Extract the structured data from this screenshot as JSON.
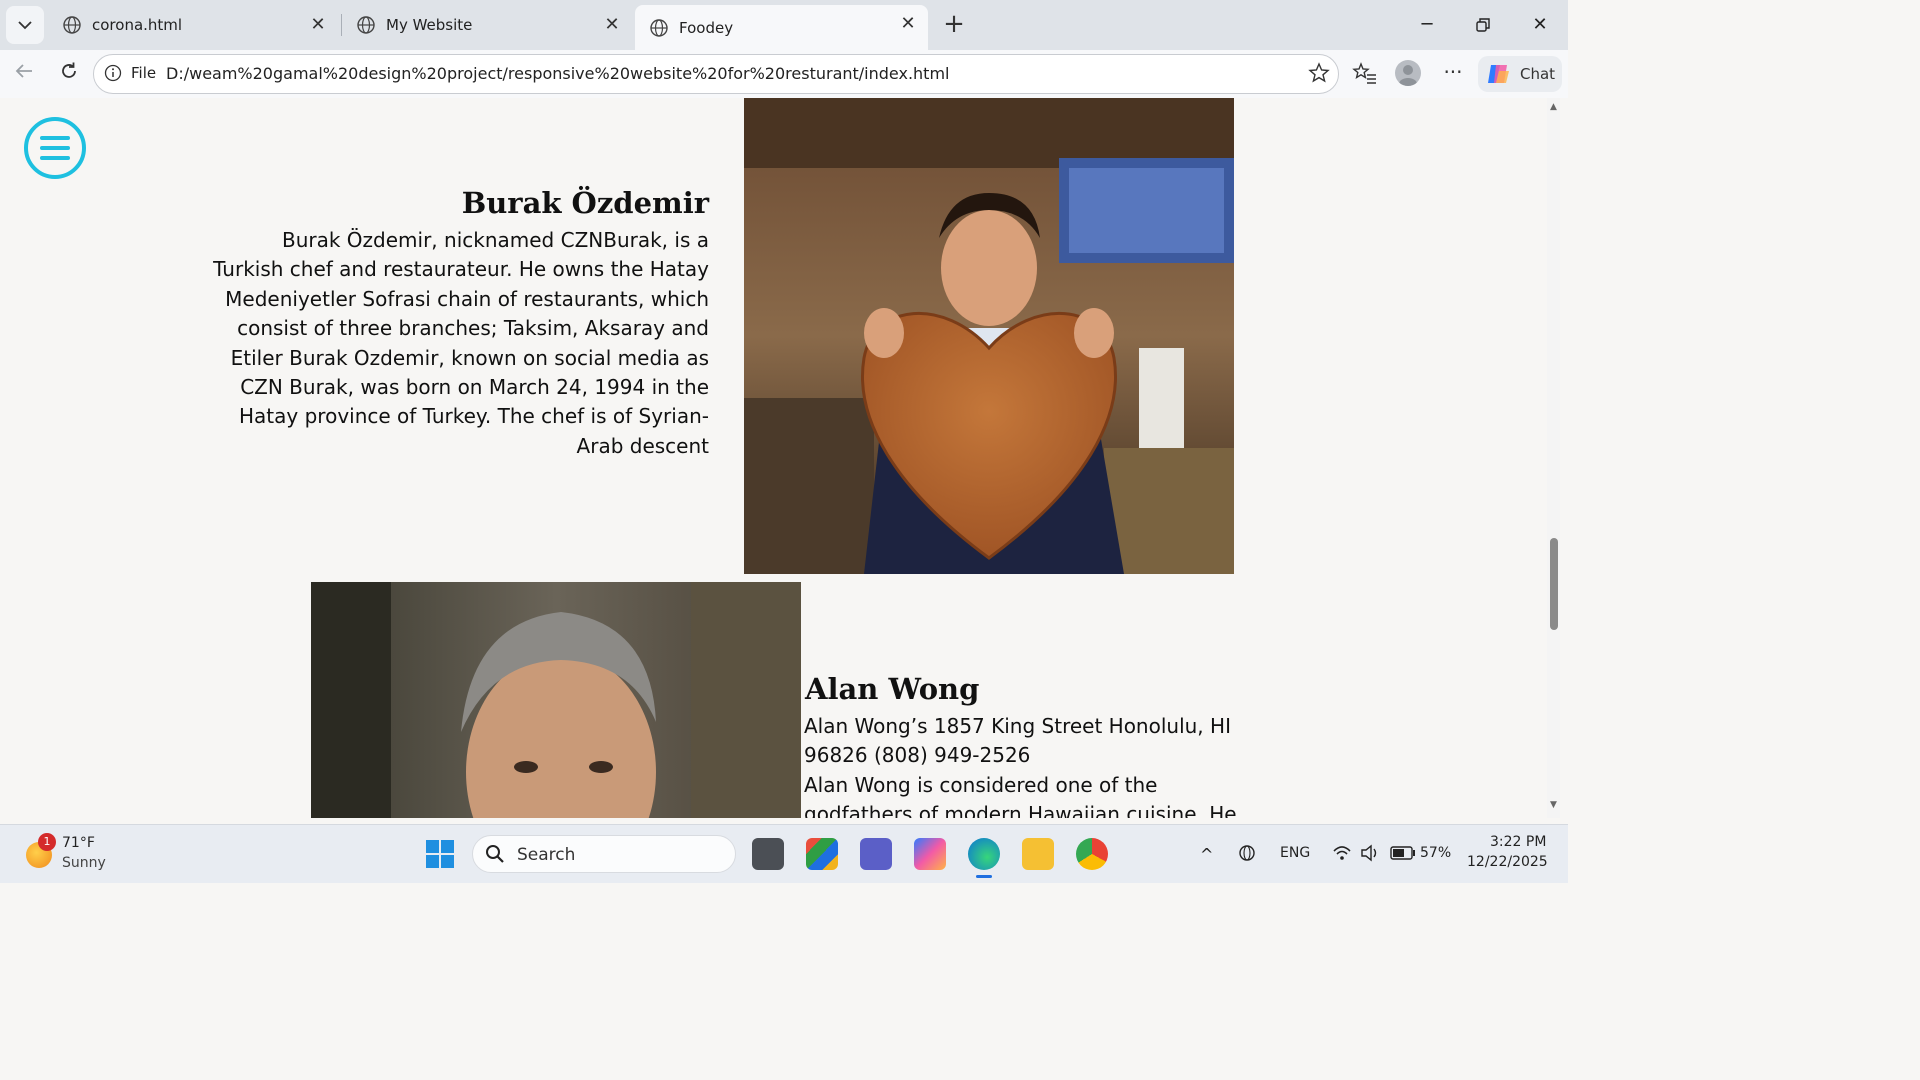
{
  "browser": {
    "tabs": [
      {
        "title": "corona.html",
        "active": false
      },
      {
        "title": "My Website",
        "active": false
      },
      {
        "title": "Foodey",
        "active": true
      }
    ],
    "address": {
      "scheme_label": "File",
      "url": "D:/weam%20gamal%20design%20project/responsive%20website%20for%20resturant/index.html"
    },
    "chat_label": "Chat"
  },
  "page": {
    "chefs": [
      {
        "name": "Burak Özdemir",
        "bio": "Burak Özdemir, nicknamed CZNBurak, is a Turkish chef and restaurateur. He owns the Hatay Medeniyetler Sofrasi chain of restaurants, which consist of three branches; Taksim, Aksaray and Etiler Burak Ozdemir, known on social media as CZN Burak, was born on March 24, 1994 in the Hatay province of Turkey. The chef is of Syrian-Arab descent"
      },
      {
        "name": "Alan Wong",
        "address": "Alan Wong’s 1857 King Street Honolulu, HI 96826 (808) 949-2526",
        "bio": "Alan Wong is considered one of the godfathers of modern Hawaiian cuisine. He"
      }
    ]
  },
  "taskbar": {
    "weather": {
      "temp": "71°F",
      "condition": "Sunny",
      "badge": "1"
    },
    "search_placeholder": "Search",
    "language": "ENG",
    "battery": "57%",
    "time": "3:22 PM",
    "date": "12/22/2025"
  },
  "colors": {
    "menu_accent": "#1ec0e0",
    "page_bg": "#f7f6f4"
  }
}
